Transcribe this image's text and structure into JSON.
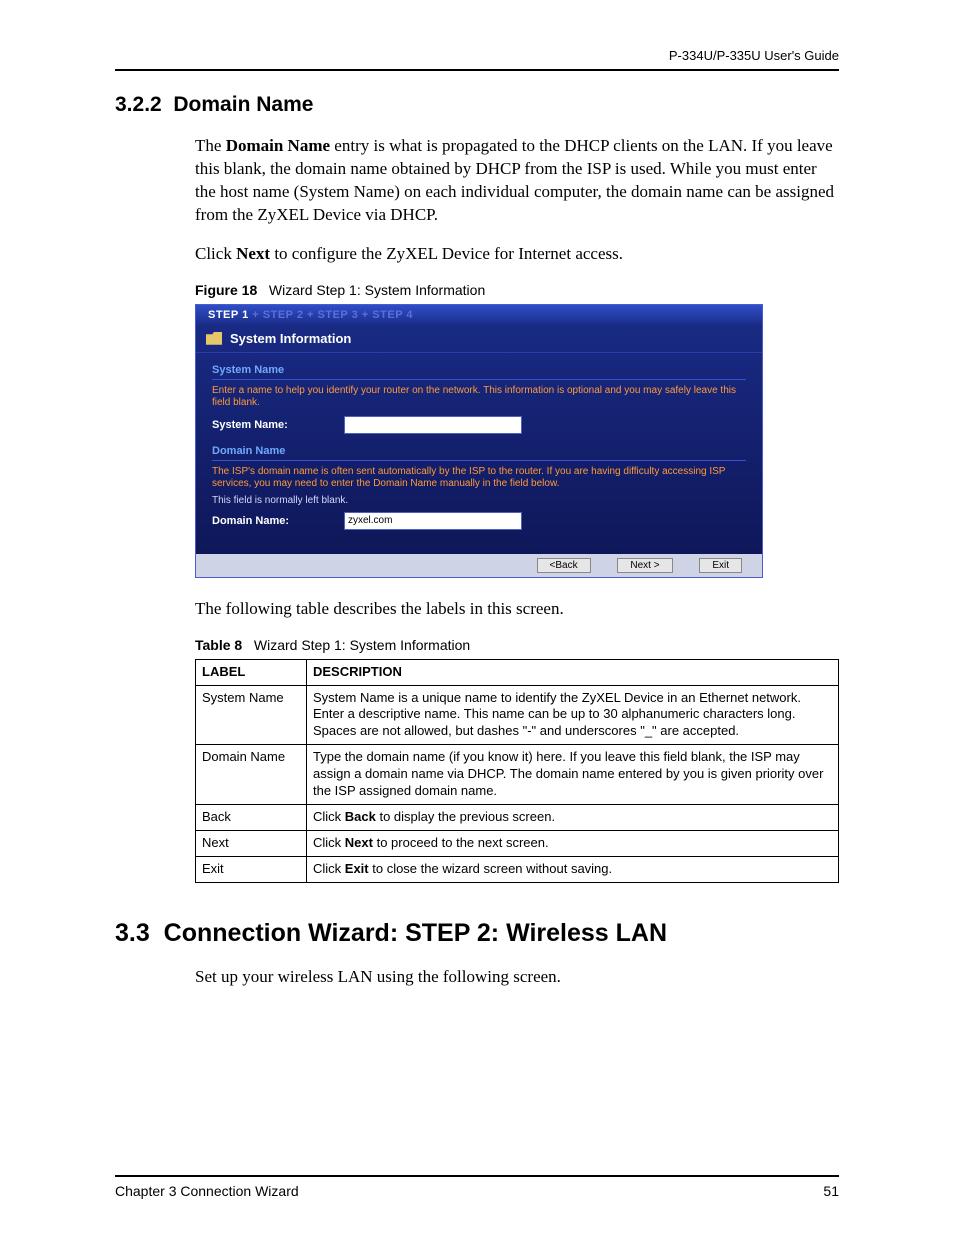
{
  "header": {
    "running": "P-334U/P-335U User's Guide"
  },
  "section322": {
    "number": "3.2.2",
    "title": "Domain Name",
    "para1_pre": "The ",
    "para1_bold": "Domain Name",
    "para1_post": " entry is what is propagated to the DHCP clients on the LAN. If you leave this blank, the domain name obtained by DHCP from the ISP is used. While you must enter the host name (System Name) on each individual computer, the domain name can be assigned from the ZyXEL Device via DHCP.",
    "para2_pre": "Click ",
    "para2_bold": "Next",
    "para2_post": " to configure the ZyXEL Device for Internet access."
  },
  "figure": {
    "label": "Figure 18",
    "title": "Wizard Step 1: System Information"
  },
  "wizard": {
    "steps": {
      "s1": "STEP 1",
      "sep": " + ",
      "s2": "STEP 2",
      "s3": "STEP 3",
      "s4": "STEP 4"
    },
    "title": "System Information",
    "sysname_heading": "System Name",
    "sysname_help": "Enter a name to help you identify your router on the network. This information is optional and you may safely leave this field blank.",
    "sysname_label": "System Name:",
    "sysname_value": "",
    "domain_heading": "Domain Name",
    "domain_help": "The ISP's domain name is often sent automatically by the ISP to the router. If you are having difficulty accessing ISP services, you may need to enter the Domain Name manually in the field below.",
    "domain_note": "This field is normally left blank.",
    "domain_label": "Domain Name:",
    "domain_value": "zyxel.com",
    "buttons": {
      "back": "<Back",
      "next": "Next >",
      "exit": "Exit"
    }
  },
  "afterFigure": "The following table describes the labels in this screen.",
  "table": {
    "label": "Table 8",
    "title": "Wizard Step 1: System Information",
    "headers": {
      "label": "LABEL",
      "desc": "DESCRIPTION"
    },
    "rows": [
      {
        "label": "System Name",
        "desc": "System Name is a unique name to identify the ZyXEL Device in an Ethernet network. Enter a descriptive name. This name can be up to 30 alphanumeric characters long. Spaces are not allowed, but dashes \"-\" and underscores \"_\" are accepted."
      },
      {
        "label": "Domain Name",
        "desc": "Type the domain name (if you know it) here. If you leave this field blank, the ISP may assign a domain name via DHCP. The domain name entered by you is given priority over the ISP assigned domain name."
      },
      {
        "label": "Back",
        "desc_pre": "Click ",
        "desc_bold": "Back",
        "desc_post": " to display the previous screen."
      },
      {
        "label": "Next",
        "desc_pre": "Click ",
        "desc_bold": "Next",
        "desc_post": " to proceed to the next screen."
      },
      {
        "label": "Exit",
        "desc_pre": "Click ",
        "desc_bold": "Exit",
        "desc_post": " to close the wizard screen without saving."
      }
    ]
  },
  "section33": {
    "number": "3.3",
    "title": "Connection Wizard: STEP 2: Wireless LAN",
    "para": "Set up your wireless LAN using the following screen."
  },
  "footer": {
    "chapter": "Chapter 3 Connection Wizard",
    "page": "51"
  }
}
